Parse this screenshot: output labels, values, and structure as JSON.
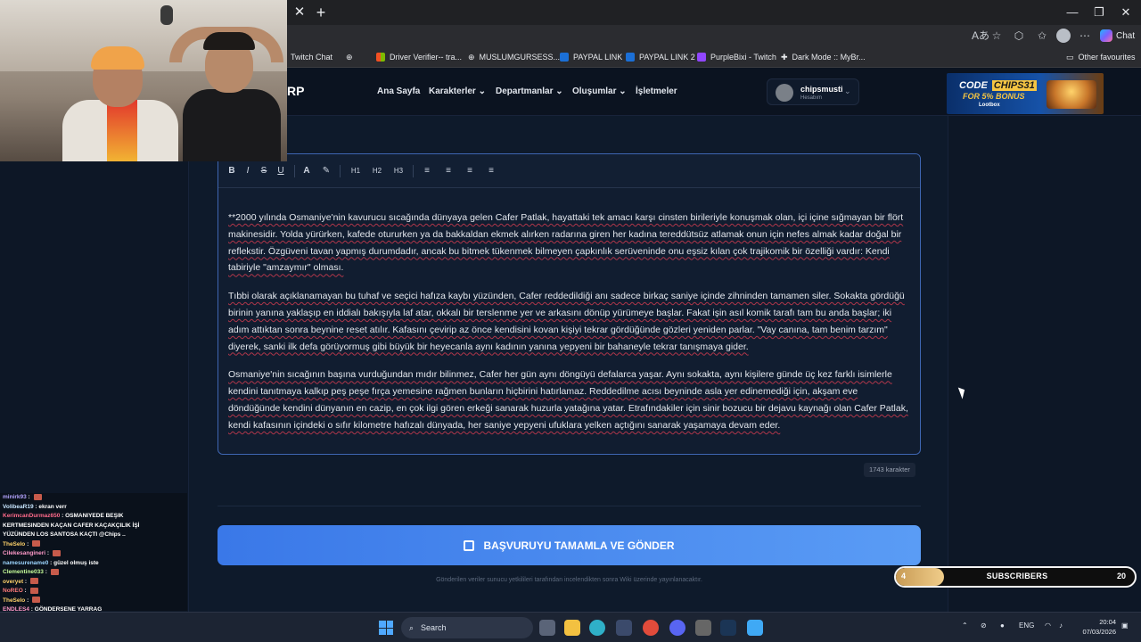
{
  "browser": {
    "bookmarks": [
      "Twitch Chat",
      "Driver Verifier-- tra...",
      "MUSLUMGURSESS...",
      "PAYPAL LINK",
      "PAYPAL LINK 2",
      "PurpleBixi - Twitch",
      "Dark Mode :: MyBr..."
    ],
    "other_favourites": "Other favourites",
    "chat_label": "Chat"
  },
  "site": {
    "brand": "RP",
    "nav": [
      "Ana Sayfa",
      "Karakterler",
      "Departmanlar",
      "Oluşumlar",
      "İşletmeler"
    ],
    "user": {
      "name": "chipsmusti",
      "subtitle": "Hesabım"
    },
    "ad": {
      "line1_prefix": "CODE",
      "line1_code": "CHIPS31",
      "line2": "FOR 5% BONUS",
      "line3": "Lootbox"
    }
  },
  "editor": {
    "toolbar": [
      "B",
      "I",
      "S",
      "U",
      "A",
      "✎",
      "H1",
      "H2",
      "H3",
      "≡",
      "≡",
      "≡",
      "≡"
    ],
    "paragraphs": [
      "**2000 yılında Osmaniye'nin kavurucu sıcağında dünyaya gelen Cafer Patlak, hayattaki tek amacı karşı cinsten birileriyle konuşmak olan, içi içine sığmayan bir flört makinesidir. Yolda yürürken, kafede otururken ya da bakkaldan ekmek alırken radarına giren her kadına tereddütsüz atlamak onun için nefes almak kadar doğal bir reflekstir. Özgüveni tavan yapmış durumdadır, ancak bu bitmek tükenmek bilmeyen çapkınlık serüveninde onu eşsiz kılan çok trajikomik bir özelliği vardır: Kendi tabiriyle \"amzaymır\" olması.",
      "Tıbbi olarak açıklanamayan bu tuhaf ve seçici hafıza kaybı yüzünden, Cafer reddedildiği anı sadece birkaç saniye içinde zihninden tamamen siler. Sokakta gördüğü birinin yanına yaklaşıp en iddialı bakışıyla laf atar, okkalı bir terslenme yer ve arkasını dönüp yürümeye başlar. Fakat işin asıl komik tarafı tam bu anda başlar; iki adım attıktan sonra beynine reset atılır. Kafasını çevirip az önce kendisini kovan kişiyi tekrar gördüğünde gözleri yeniden parlar. \"Vay canına, tam benim tarzım\" diyerek, sanki ilk defa görüyormuş gibi büyük bir heyecanla aynı kadının yanına yepyeni bir bahaneyle tekrar tanışmaya gider.",
      "Osmaniye'nin sıcağının başına vurduğundan mıdır bilinmez, Cafer her gün aynı döngüyü defalarca yaşar. Aynı sokakta, aynı kişilere günde üç kez farklı isimlerle kendini tanıtmaya kalkıp peş peşe fırça yemesine rağmen bunların hiçbirini hatırlamaz. Reddedilme acısı beyninde asla yer edinemediği için, akşam eve döndüğünde kendini dünyanın en cazip, en çok ilgi gören erkeği sanarak huzurla yatağına yatar. Etrafındakiler için sinir bozucu bir dejavu kaynağı olan Cafer Patlak, kendi kafasının içindeki o sıfır kilometre hafızalı dünyada, her saniye yepyeni ufuklara yelken açtığını sanarak yaşamaya devam eder."
    ],
    "char_count": "1743 karakter"
  },
  "submit": {
    "label": "BAŞVURUYU TAMAMLA VE GÖNDER"
  },
  "footnote": "Gönderilen veriler sunucu yetkilileri tarafından incelendikten sonra Wiki üzerinde yayınlanacaktır.",
  "stream_chat": [
    {
      "user": "minirk93",
      "msg": ""
    },
    {
      "user": "VolibeaR19",
      "msg": "ekran verr"
    },
    {
      "user": "KerimcanDurmaz650",
      "msg": "OSMANIYEDE BEŞIK"
    },
    {
      "user": "",
      "msg": "KERTMESINDEN KAÇAN CAFER KAÇAKÇILIK İŞİ"
    },
    {
      "user": "",
      "msg": "YÜZÜNDEN LOS SANTOSA KAÇTI @Chips .."
    },
    {
      "user": "TheSelo",
      "msg": ""
    },
    {
      "user": "Cilekesangineri",
      "msg": ""
    },
    {
      "user": "namesurename0",
      "msg": "güzel olmuş iste"
    },
    {
      "user": "Clementine033",
      "msg": ""
    },
    {
      "user": "overyet",
      "msg": ""
    },
    {
      "user": "NoREO",
      "msg": ""
    },
    {
      "user": "TheSelo",
      "msg": ""
    },
    {
      "user": "ENDLES4",
      "msg": "GÖNDERSENE YARRAG"
    }
  ],
  "subs_widget": {
    "current": "4",
    "label": "SUBSCRIBERS",
    "goal": "20",
    "progress": 0.2
  },
  "taskbar": {
    "search_label": "Search",
    "lang": "ENG",
    "time": "20:04",
    "date": "07/03/2026"
  }
}
